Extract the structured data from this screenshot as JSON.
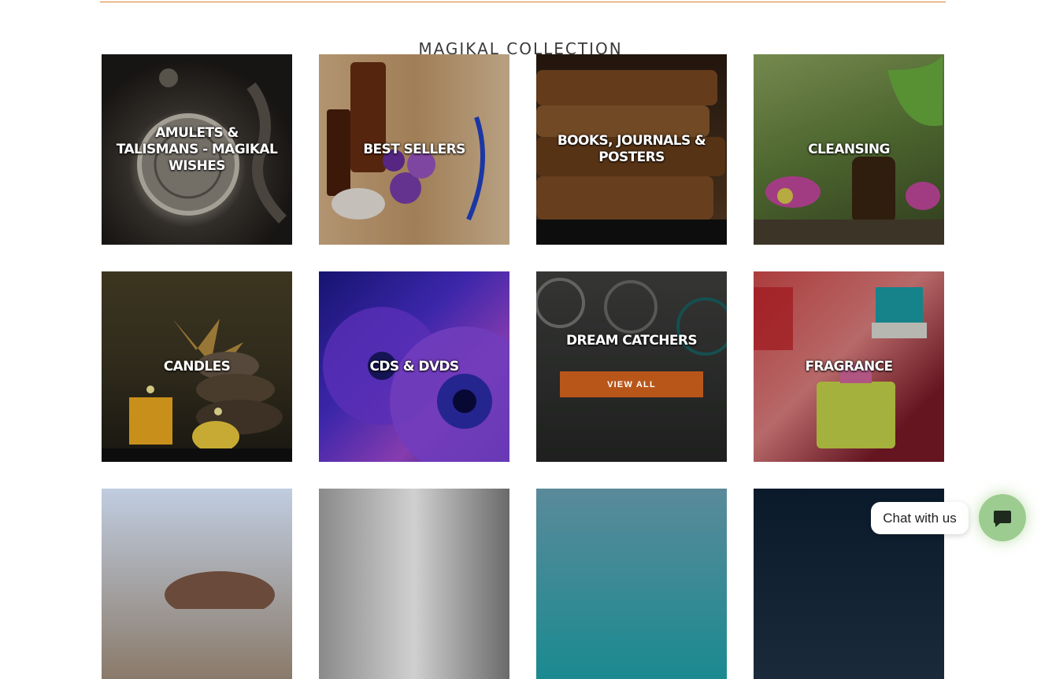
{
  "section": {
    "title": "MAGIKAL COLLECTION"
  },
  "tiles": [
    {
      "label": "AMULETS & TALISMANS - MAGIKAL WISHES"
    },
    {
      "label": "BEST SELLERS"
    },
    {
      "label": "BOOKS, JOURNALS & POSTERS"
    },
    {
      "label": "CLEANSING"
    },
    {
      "label": "CANDLES"
    },
    {
      "label": "CDS & DVDS"
    },
    {
      "label": "DREAM CATCHERS",
      "button": "VIEW ALL"
    },
    {
      "label": "FRAGRANCE"
    },
    {
      "label": ""
    },
    {
      "label": ""
    },
    {
      "label": ""
    },
    {
      "label": ""
    }
  ],
  "chat": {
    "bubble_text": "Chat with us",
    "icon": "chat-icon"
  },
  "colors": {
    "accent": "#d9822b",
    "button": "#b8561a",
    "chat_button": "#9ccc90"
  }
}
